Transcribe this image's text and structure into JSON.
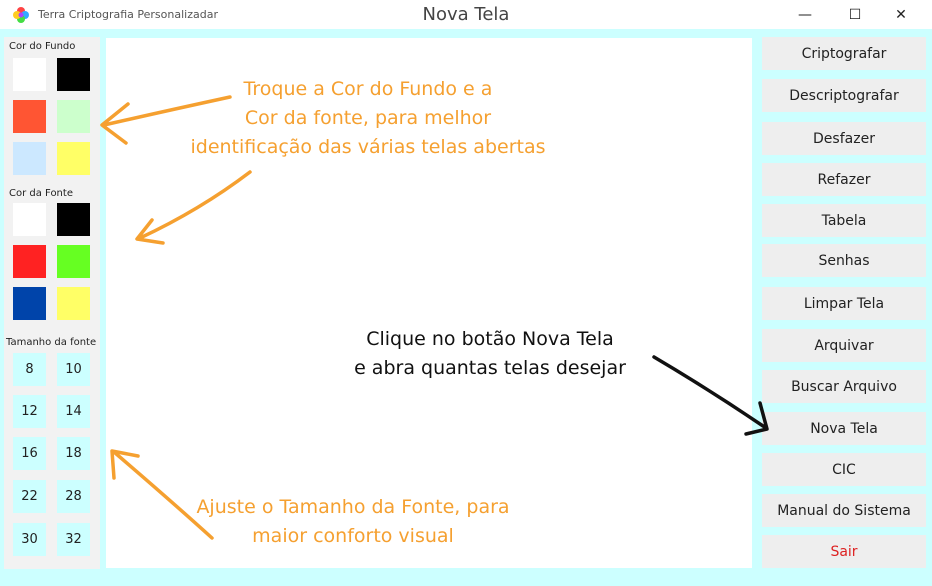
{
  "window": {
    "app_name": "Terra Criptografia Personalizadar",
    "title": "Nova Tela",
    "minimize_glyph": "—",
    "maximize_glyph": "☐",
    "close_glyph": "✕"
  },
  "left_panel": {
    "bg_label": "Cor do Fundo",
    "font_color_label": "Cor da Fonte",
    "font_size_label": "Tamanho da fonte",
    "bg_colors": [
      "#ffffff",
      "#000000",
      "#ff5533",
      "#ccffcc",
      "#cce8ff",
      "#ffff66"
    ],
    "font_colors": [
      "#ffffff",
      "#000000",
      "#ff2222",
      "#66ff22",
      "#0044aa",
      "#ffff66"
    ],
    "font_sizes": [
      "8",
      "10",
      "12",
      "14",
      "16",
      "18",
      "22",
      "28",
      "30",
      "32"
    ]
  },
  "buttons": [
    "Criptografar",
    "Descriptografar",
    "Desfazer",
    "Refazer",
    "Tabela",
    "Senhas",
    "Limpar Tela",
    "Arquivar",
    "Buscar Arquivo",
    "Nova Tela",
    "CIC",
    "Manual do Sistema",
    "Sair"
  ],
  "annotations": {
    "colors_line1": "Troque a Cor do Fundo e a",
    "colors_line2": "Cor da fonte, para melhor",
    "colors_line3": "identificação das várias telas abertas",
    "newscreen_line1": "Clique no botão Nova Tela",
    "newscreen_line2": "e abra quantas telas desejar",
    "fontsize_line1": "Ajuste o Tamanho da Fonte, para",
    "fontsize_line2": "maior conforto visual"
  },
  "colors": {
    "accent_orange": "#f5a030",
    "background_cyan": "#ccffff",
    "exit_red": "#dd2222"
  }
}
